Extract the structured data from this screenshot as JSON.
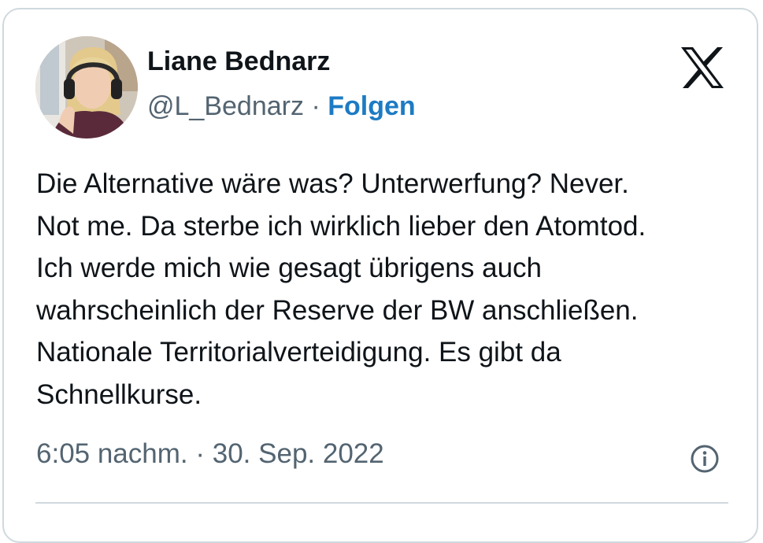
{
  "author": {
    "display_name": "Liane Bednarz",
    "handle": "@L_Bednarz",
    "separator": "·",
    "follow_label": "Folgen"
  },
  "tweet": {
    "text": "Die Alternative wäre was? Unterwerfung? Never.\nNot me. Da sterbe ich wirklich lieber den Atomtod.\nIch werde mich wie gesagt übrigens auch\nwahrscheinlich der Reserve der BW anschließen.\nNationale Territorialverteidigung. Es gibt da\nSchnellkurse.",
    "time": "6:05 nachm.",
    "separator": "·",
    "date": "30. Sep. 2022"
  },
  "icons": {
    "brand": "x-logo-icon",
    "info": "info-icon"
  },
  "colors": {
    "follow_link": "#1d7bc4",
    "secondary_text": "#536471",
    "primary_text": "#0f1419",
    "border": "#cfd9de"
  }
}
